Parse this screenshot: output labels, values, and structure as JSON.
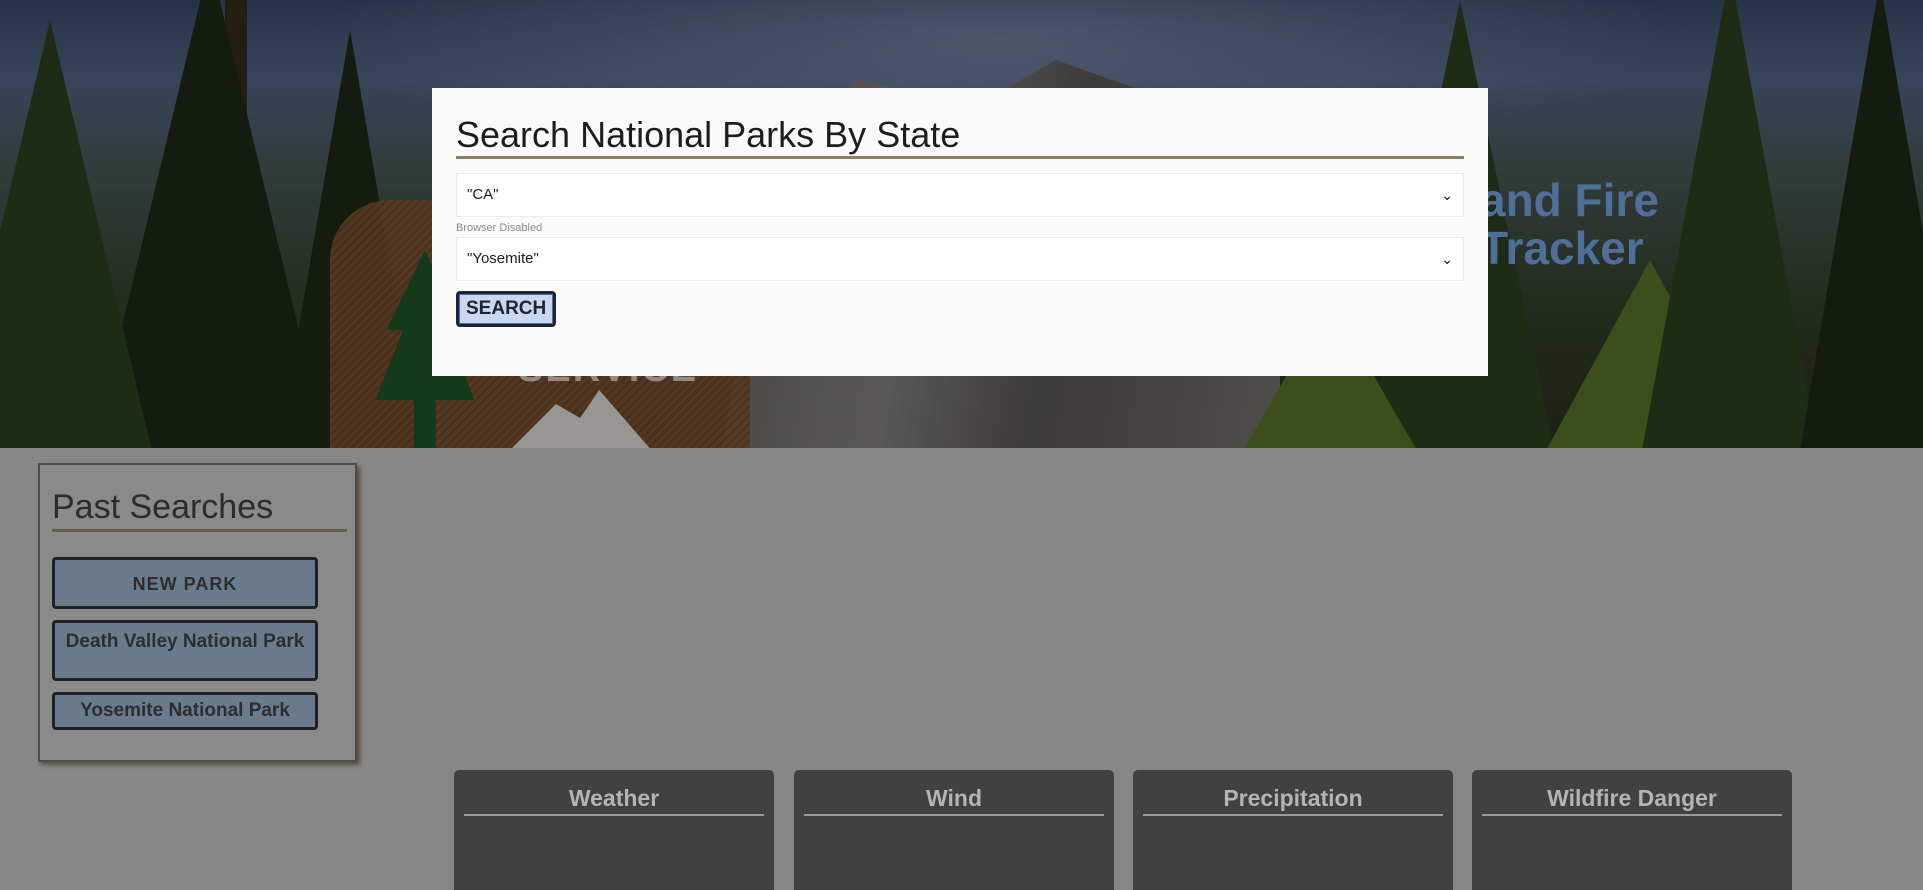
{
  "hero": {
    "title": "and Fire Tracker",
    "badge_text": "SERVICE"
  },
  "search_modal": {
    "heading": "Search National Parks By State",
    "state_select_value": "\"CA\"",
    "hint": "Browser Disabled",
    "park_select_value": "\"Yosemite\"",
    "search_button": "SEARCH"
  },
  "past_searches": {
    "heading": "Past Searches",
    "buttons": [
      {
        "label": "NEW PARK"
      },
      {
        "label": "Death Valley National Park"
      },
      {
        "label": "Yosemite National Park"
      }
    ]
  },
  "cards": [
    {
      "title": "Weather"
    },
    {
      "title": "Wind"
    },
    {
      "title": "Precipitation"
    },
    {
      "title": "Wildfire Danger"
    }
  ],
  "colors": {
    "overlay_gray": "#878787",
    "modal_bg": "#fafafa",
    "heading_rule": "#8d7d63",
    "search_button_bg": "#c9d8ee",
    "past_button_bg": "#6b7b8e",
    "card_bg": "#414141"
  }
}
